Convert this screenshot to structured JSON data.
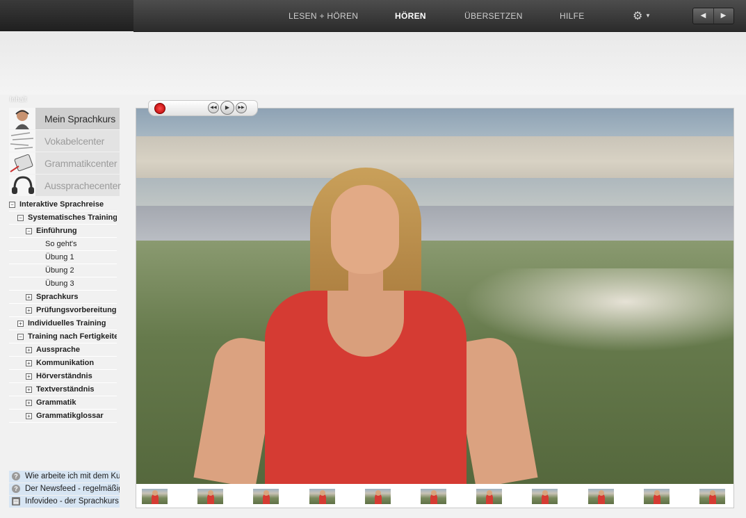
{
  "nav": {
    "items": [
      {
        "label": "LESEN + HÖREN",
        "active": false
      },
      {
        "label": "HÖREN",
        "active": true
      },
      {
        "label": "ÜBERSETZEN",
        "active": false
      },
      {
        "label": "HILFE",
        "active": false
      }
    ],
    "settings_icon": "gear-icon",
    "prev_icon": "triangle-left-icon",
    "next_icon": "triangle-right-icon"
  },
  "sidebar": {
    "section_label": "Inhalt",
    "tiles": [
      {
        "label": "Mein Sprachkurs",
        "active": true,
        "icon": "headset-person-icon"
      },
      {
        "label": "Vokabelcenter",
        "active": false,
        "icon": "word-cloud-icon"
      },
      {
        "label": "Grammatikcenter",
        "active": false,
        "icon": "tablet-pen-icon"
      },
      {
        "label": "Aussprachecenter",
        "active": false,
        "icon": "headphones-icon"
      }
    ],
    "tree": [
      {
        "label": "Interaktive Sprachreise",
        "toggle": "−",
        "level": 0,
        "bold": true
      },
      {
        "label": "Systematisches Training",
        "toggle": "−",
        "level": 1,
        "bold": true
      },
      {
        "label": "Einführung",
        "toggle": "−",
        "level": 2,
        "bold": true
      },
      {
        "label": "So geht's",
        "toggle": "",
        "level": 3,
        "bold": false
      },
      {
        "label": "Übung 1",
        "toggle": "",
        "level": 3,
        "bold": false
      },
      {
        "label": "Übung 2",
        "toggle": "",
        "level": 3,
        "bold": false
      },
      {
        "label": "Übung 3",
        "toggle": "",
        "level": 3,
        "bold": false
      },
      {
        "label": "Sprachkurs",
        "toggle": "+",
        "level": 2,
        "bold": true
      },
      {
        "label": "Prüfungsvorbereitung",
        "toggle": "+",
        "level": 2,
        "bold": true
      },
      {
        "label": "Individuelles Training",
        "toggle": "+",
        "level": 1,
        "bold": true
      },
      {
        "label": "Training nach Fertigkeiten",
        "toggle": "−",
        "level": 1,
        "bold": true
      },
      {
        "label": "Aussprache",
        "toggle": "+",
        "level": 2,
        "bold": true
      },
      {
        "label": "Kommunikation",
        "toggle": "+",
        "level": 2,
        "bold": true
      },
      {
        "label": "Hörverständnis",
        "toggle": "+",
        "level": 2,
        "bold": true
      },
      {
        "label": "Textverständnis",
        "toggle": "+",
        "level": 2,
        "bold": true
      },
      {
        "label": "Grammatik",
        "toggle": "+",
        "level": 2,
        "bold": true
      },
      {
        "label": "Grammatikglossar",
        "toggle": "+",
        "level": 2,
        "bold": true
      }
    ],
    "help": [
      {
        "label": "Wie arbeite ich mit dem Kurs?",
        "icon": "help-circle-icon"
      },
      {
        "label": "Der Newsfeed - regelmäßig neue Inhalte",
        "icon": "help-circle-icon"
      },
      {
        "label": "Infovideo - der Sprachkurs",
        "icon": "film-icon"
      }
    ]
  },
  "player": {
    "record_icon": "record-icon",
    "rewind_icon": "rewind-icon",
    "play_icon": "play-icon",
    "forward_icon": "fast-forward-icon",
    "thumbnail_count": 11
  }
}
